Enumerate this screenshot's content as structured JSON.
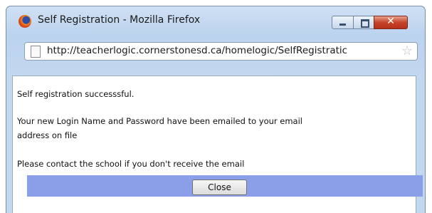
{
  "window": {
    "title": "Self Registration - Mozilla Firefox",
    "controls": {
      "minimize": "minimize",
      "maximize": "maximize",
      "close": "✕"
    }
  },
  "address_bar": {
    "url": "http://teacherlogic.cornerstonesd.ca/homelogic/SelfRegistratic"
  },
  "page": {
    "line1": "Self registration successsful.",
    "line2": "Your new Login Name and Password have been emailed to your email",
    "line3": "address on file",
    "line4": "Please contact the school if you don't receive the email",
    "close_label": "Close"
  },
  "colors": {
    "action_bar": "#8b9ee8",
    "close_control": "#c6432a"
  }
}
